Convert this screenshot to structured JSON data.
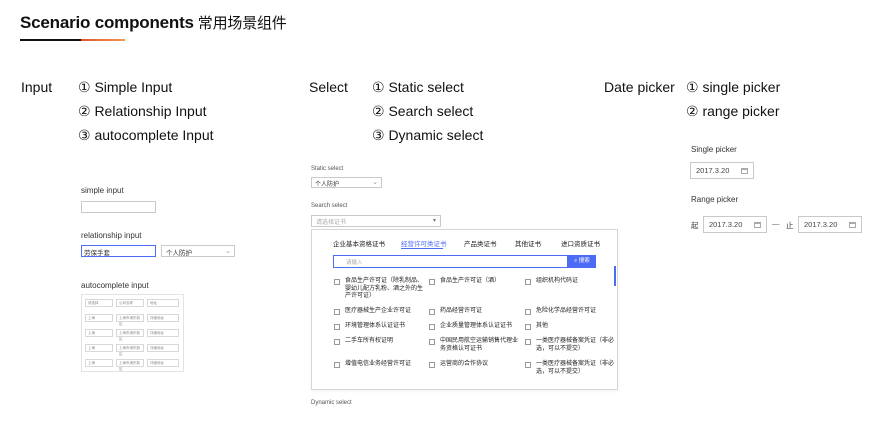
{
  "header": {
    "title_en": "Scenario components",
    "title_cn": "常用场景组件"
  },
  "input_section": {
    "category": "Input",
    "items": [
      "① Simple Input",
      "② Relationship Input",
      "③ autocomplete Input"
    ],
    "simple_label": "simple input",
    "relationship_label": "relationship input",
    "relationship_value": "劳保手套",
    "relationship_select": "个人防护",
    "autocomplete_label": "autocomplete input",
    "autocomplete_rows": [
      [
        "请选择",
        "公司名称",
        "地址"
      ],
      [
        "上海",
        "上海市浦东新区",
        "详细地址"
      ],
      [
        "上海",
        "上海市浦东新区",
        "详细地址"
      ],
      [
        "上海",
        "上海市浦东新区",
        "详细地址"
      ],
      [
        "上海",
        "上海市浦东新区",
        "详细地址"
      ]
    ]
  },
  "select_section": {
    "category": "Select",
    "items": [
      "① Static select",
      "② Search select",
      "③ Dynamic select"
    ],
    "static_label": "Static select",
    "static_value": "个人防护",
    "search_label": "Search select",
    "search_placeholder": "请选择证书",
    "dropdown_tabs": [
      "企业基本资格证书",
      "经营许可类证书",
      "产品类证书",
      "其他证书",
      "进口资质证书"
    ],
    "search_input_placeholder": "请输入",
    "search_button": "搜索",
    "options": [
      [
        "食品生产许可证（除乳制品、婴幼儿配方乳粉、酒之外的生产许可证）",
        "食品生产许可证（酒）",
        "组织机构代码证"
      ],
      [
        "医疗器械生产企业许可证",
        "药品经营许可证",
        "危险化学品经营许可证"
      ],
      [
        "环境管理体系认证证书",
        "企业质量管理体系认证证书",
        "其他"
      ],
      [
        "二手车所有权证明",
        "中国民用航空运输销售代理业务资格认可证书",
        "一类医疗器械备案凭证（非必选，可以不提交）"
      ],
      [
        "增值电信业务经营许可证",
        "运营商的合作协议",
        "一类医疗器械备案凭证（非必选，可以不提交）"
      ]
    ],
    "dynamic_label": "Dynamic select"
  },
  "date_section": {
    "category": "Date picker",
    "items": [
      "① single picker",
      "② range picker"
    ],
    "single_label": "Single picker",
    "single_value": "2017.3.20",
    "range_label": "Range picker",
    "range_start_prefix": "起",
    "range_start": "2017.3.20",
    "range_sep": "—",
    "range_end_prefix": "止",
    "range_end": "2017.3.20"
  },
  "colors": {
    "accent_blue": "#4d6cf5",
    "accent_orange": "#e0552b",
    "text_dark": "#111111",
    "border": "#c9c9c9"
  }
}
